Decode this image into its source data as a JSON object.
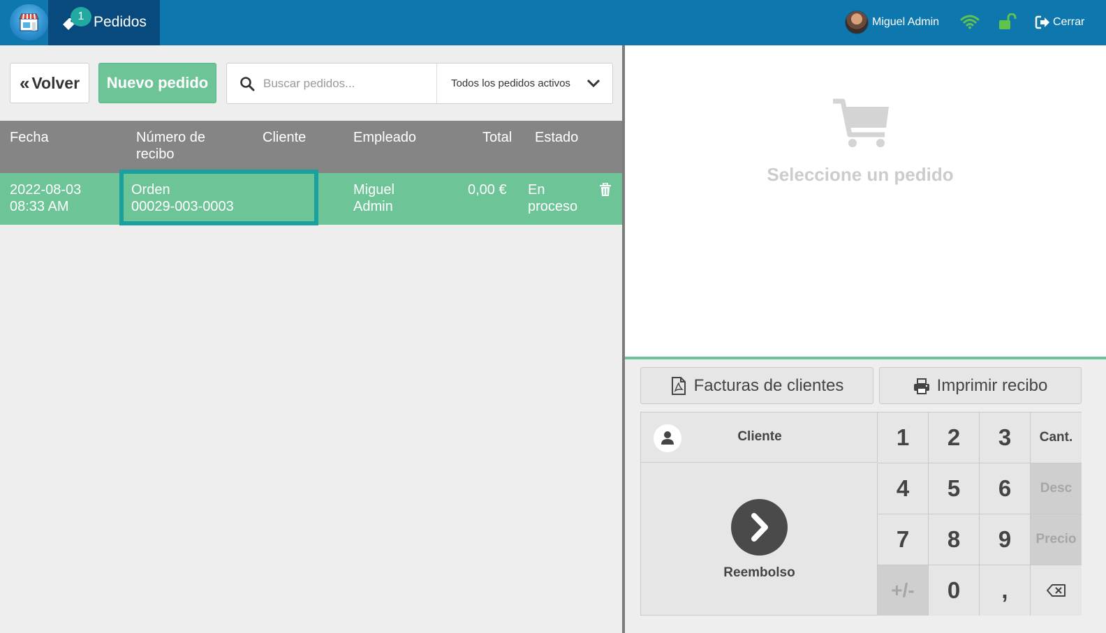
{
  "topbar": {
    "badge_count": "1",
    "nav_label": "Pedidos",
    "user_name": "Miguel Admin",
    "logout_label": "Cerrar",
    "colors": {
      "bar": "#0e77ad",
      "active_tab": "#084a7d",
      "wifi": "#5fc44c",
      "lock": "#5fc44c"
    }
  },
  "toolbar": {
    "back_label": "Volver",
    "new_order_label": "Nuevo pedido",
    "search_placeholder": "Buscar pedidos...",
    "filter_selected": "Todos los pedidos activos"
  },
  "orders_table": {
    "columns": {
      "fecha": "Fecha",
      "recibo_line1": "Número de",
      "recibo_line2": "recibo",
      "cliente": "Cliente",
      "empleado": "Empleado",
      "total": "Total",
      "estado": "Estado"
    },
    "rows": [
      {
        "fecha_1": "2022-08-03",
        "fecha_2": "08:33 AM",
        "recibo_1": "Orden",
        "recibo_2": "00029-003-0003",
        "cliente": "",
        "empleado_1": "Miguel",
        "empleado_2": "Admin",
        "total": "0,00 €",
        "estado_1": "En",
        "estado_2": "proceso"
      }
    ]
  },
  "detail": {
    "empty_message": "Seleccione un pedido"
  },
  "actions": {
    "facturas_label": "Facturas de clientes",
    "imprimir_label": "Imprimir recibo",
    "cliente_label": "Cliente",
    "reembolso_label": "Reembolso"
  },
  "keypad": {
    "k1": "1",
    "k2": "2",
    "k3": "3",
    "qty": "Cant.",
    "k4": "4",
    "k5": "5",
    "k6": "6",
    "disc": "Desc",
    "k7": "7",
    "k8": "8",
    "k9": "9",
    "price": "Precio",
    "sign": "+/-",
    "k0": "0",
    "comma": ","
  }
}
